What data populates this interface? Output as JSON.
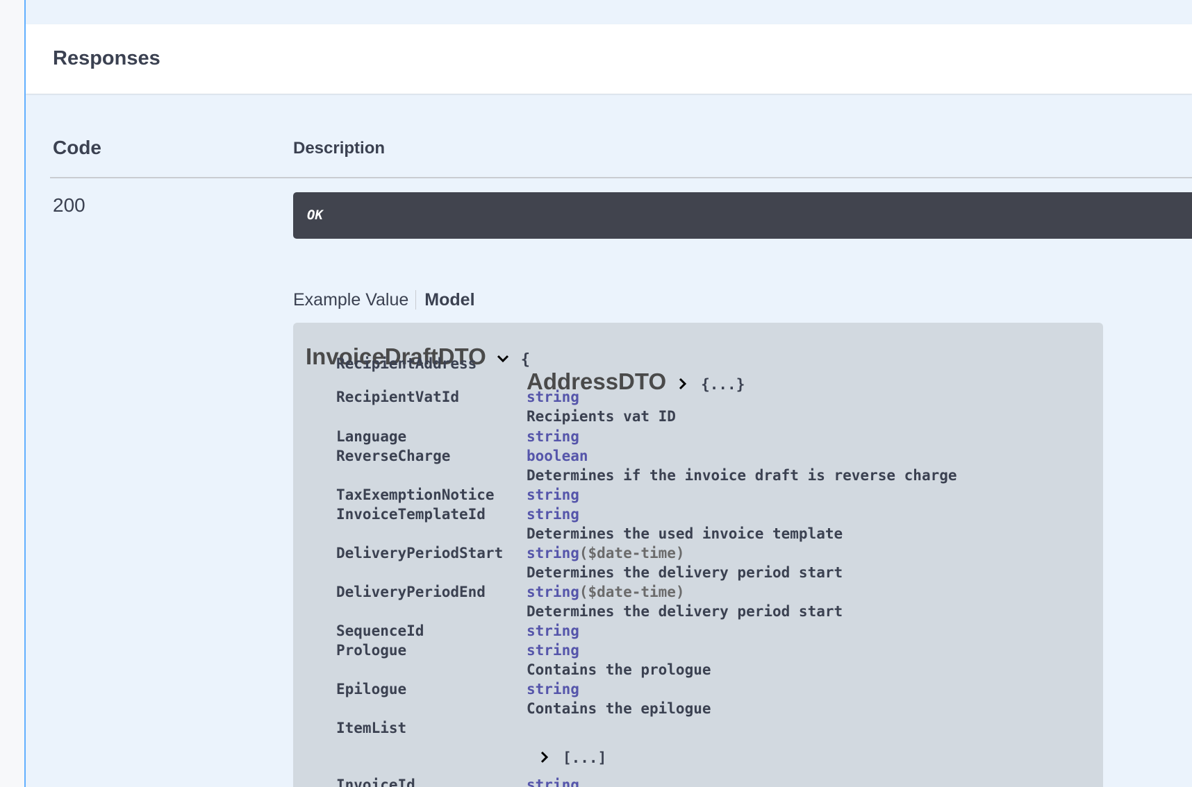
{
  "responses": {
    "title": "Responses",
    "columns": {
      "code": "Code",
      "description": "Description"
    },
    "rows": [
      {
        "code": "200",
        "description": "OK"
      }
    ]
  },
  "tabs": {
    "example_value": "Example Value",
    "model": "Model",
    "active": "Model"
  },
  "model": {
    "name": "InvoiceDraftDTO",
    "open_brace": "{",
    "icons": {
      "expand": "chevron-down-icon",
      "collapsed": "chevron-right-icon"
    },
    "properties": [
      {
        "name": "RecipientAddress",
        "ref": "AddressDTO",
        "ref_body": "{...}"
      },
      {
        "name": "RecipientVatId",
        "type": "string",
        "description": "Recipients vat ID"
      },
      {
        "name": "Language",
        "type": "string"
      },
      {
        "name": "ReverseCharge",
        "type": "boolean",
        "description": "Determines if the invoice draft is reverse charge"
      },
      {
        "name": "TaxExemptionNotice",
        "type": "string"
      },
      {
        "name": "InvoiceTemplateId",
        "type": "string",
        "description": "Determines the used invoice template"
      },
      {
        "name": "DeliveryPeriodStart",
        "type": "string",
        "format": "($date-time)",
        "description": "Determines the delivery period start"
      },
      {
        "name": "DeliveryPeriodEnd",
        "type": "string",
        "format": "($date-time)",
        "description": "Determines the delivery period start"
      },
      {
        "name": "SequenceId",
        "type": "string"
      },
      {
        "name": "Prologue",
        "type": "string",
        "description": "Contains the prologue"
      },
      {
        "name": "Epilogue",
        "type": "string",
        "description": "Contains the epilogue"
      },
      {
        "name": "ItemList",
        "array_body": "[...]"
      },
      {
        "name": "InvoiceId",
        "type": "string"
      }
    ]
  },
  "colors": {
    "accent": "#61affe",
    "type": "#5555aa",
    "dark_box": "#41444e",
    "model_bg": "#d2d9e0"
  }
}
